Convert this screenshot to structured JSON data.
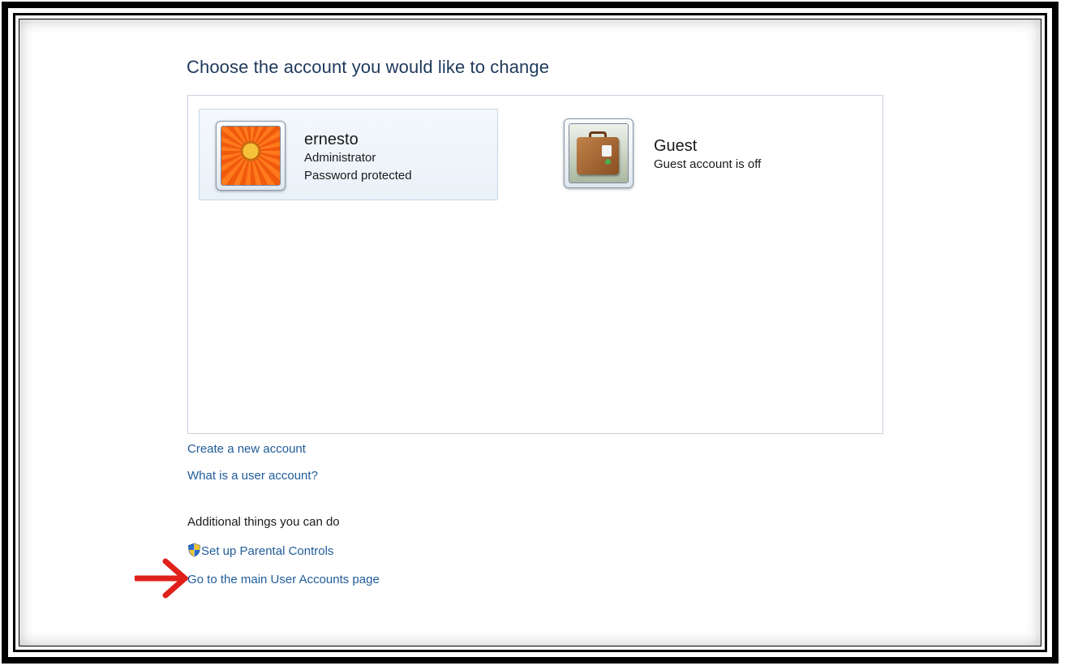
{
  "page": {
    "heading": "Choose the account you would like to change"
  },
  "accounts": [
    {
      "name": "ernesto",
      "details": [
        "Administrator",
        "Password protected"
      ],
      "picture_icon": "orange-flower"
    },
    {
      "name": "Guest",
      "details": [
        "Guest account is off"
      ],
      "picture_icon": "suitcase"
    }
  ],
  "links": {
    "create_account": "Create a new account",
    "what_is_account": "What is a user account?"
  },
  "additional": {
    "title": "Additional things you can do",
    "parental_controls": "Set up Parental Controls",
    "parental_controls_icon": "shield-icon",
    "main_page": "Go to the main User Accounts page"
  },
  "annotation": {
    "arrow_icon": "red-arrow",
    "arrow_color": "#e0201a"
  },
  "colors": {
    "heading": "#1e395b",
    "link": "#1f5c99",
    "frame": "#000000"
  }
}
